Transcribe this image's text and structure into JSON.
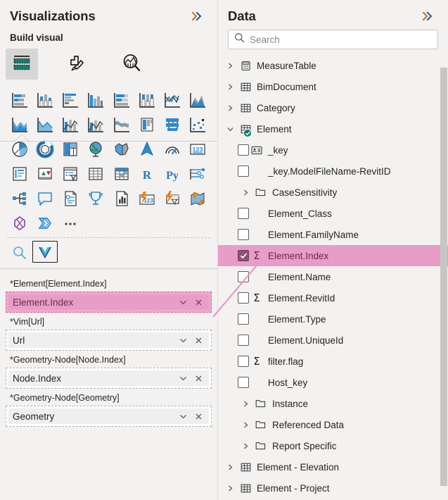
{
  "visualizations": {
    "title": "Visualizations",
    "expand_icon": "double-chevron-right-icon",
    "build_visual_label": "Build visual",
    "tabs": [
      {
        "id": "build",
        "label": "Build visual",
        "icon": "build-visual-icon",
        "selected": true
      },
      {
        "id": "format",
        "label": "Format visual",
        "icon": "paintbrush-icon",
        "selected": false
      },
      {
        "id": "analytics",
        "label": "Analytics",
        "icon": "analytics-magnifier-icon",
        "selected": false
      }
    ],
    "gallery": [
      "stacked-bar-chart-icon",
      "stacked-column-chart-icon",
      "clustered-bar-chart-icon",
      "clustered-column-chart-icon",
      "100-stacked-bar-chart-icon",
      "100-stacked-column-chart-icon",
      "line-chart-icon",
      "area-chart-icon",
      "stacked-area-chart-icon",
      "line-and-stacked-column-icon",
      "line-and-clustered-column-icon",
      "ribbon-chart-icon",
      "waterfall-chart-icon",
      "funnel-chart-icon",
      "scatter-chart-icon",
      "pie-chart-icon",
      "donut-chart-icon",
      "treemap-icon",
      "map-icon",
      "filled-map-icon",
      "azure-map-icon",
      "gauge-icon",
      "card-icon",
      "multi-row-card-icon",
      "kpi-icon",
      "slicer-icon",
      "table-icon",
      "matrix-icon",
      "r-script-visual-icon",
      "python-visual-icon",
      "key-influencers-icon",
      "decomposition-tree-icon",
      "q-and-a-icon",
      "smart-narrative-icon",
      "metrics-icon",
      "paginated-report-icon",
      "power-apps-icon",
      "power-automate-icon",
      "arcgis-maps-icon",
      "deneb-icon",
      "charticulator-icon",
      "more-options-icon"
    ],
    "bottom_row": [
      {
        "icon": "get-more-visuals-search-icon",
        "selected": false
      },
      {
        "icon": "custom-visual-icon",
        "selected": true
      }
    ],
    "wells": [
      {
        "label": "*Element[Element.Index]",
        "value": "Element.Index",
        "highlighted": true,
        "dropdown_icon": "chevron-down-icon",
        "remove_icon": "close-x-icon"
      },
      {
        "label": "*Vim[Url]",
        "value": "Url",
        "highlighted": false,
        "dropdown_icon": "chevron-down-icon",
        "remove_icon": "close-x-icon"
      },
      {
        "label": "*Geometry-Node[Node.Index]",
        "value": "Node.Index",
        "highlighted": false,
        "dropdown_icon": "chevron-down-icon",
        "remove_icon": "close-x-icon"
      },
      {
        "label": "*Geometry-Node[Geometry]",
        "value": "Geometry",
        "highlighted": false,
        "dropdown_icon": "chevron-down-icon",
        "remove_icon": "close-x-icon"
      }
    ]
  },
  "data_pane": {
    "title": "Data",
    "expand_icon": "double-chevron-right-icon",
    "search": {
      "value": "",
      "placeholder": "Search",
      "icon": "search-icon"
    },
    "tree": [
      {
        "label": "MeasureTable",
        "kind": "measure-table",
        "indent": 0,
        "twisty": "collapsed",
        "icon": "measure-table-icon"
      },
      {
        "label": "BimDocument",
        "kind": "table",
        "indent": 0,
        "twisty": "collapsed",
        "icon": "table-icon"
      },
      {
        "label": "Category",
        "kind": "table",
        "indent": 0,
        "twisty": "collapsed",
        "icon": "table-icon"
      },
      {
        "label": "Element",
        "kind": "table",
        "indent": 0,
        "twisty": "expanded",
        "icon": "table-icon",
        "badge": "active-check-badge"
      },
      {
        "label": "_key",
        "kind": "field",
        "indent": 1,
        "checked": false,
        "icon": "key-field-icon"
      },
      {
        "label": "_key.ModelFileName-RevitID",
        "kind": "field",
        "indent": 1,
        "checked": false
      },
      {
        "label": "CaseSensitivity",
        "kind": "folder",
        "indent": 1,
        "twisty": "collapsed",
        "icon": "folder-icon"
      },
      {
        "label": "Element_Class",
        "kind": "field",
        "indent": 1,
        "checked": false
      },
      {
        "label": "Element.FamilyName",
        "kind": "field",
        "indent": 1,
        "checked": false
      },
      {
        "label": "Element.Index",
        "kind": "field",
        "indent": 1,
        "checked": true,
        "measure": true,
        "selected": true
      },
      {
        "label": "Element.Name",
        "kind": "field",
        "indent": 1,
        "checked": false
      },
      {
        "label": "Element.RevitId",
        "kind": "field",
        "indent": 1,
        "checked": false,
        "measure": true
      },
      {
        "label": "Element.Type",
        "kind": "field",
        "indent": 1,
        "checked": false
      },
      {
        "label": "Element.UniqueId",
        "kind": "field",
        "indent": 1,
        "checked": false
      },
      {
        "label": "filter.flag",
        "kind": "field",
        "indent": 1,
        "checked": false,
        "measure": true
      },
      {
        "label": "Host_key",
        "kind": "field",
        "indent": 1,
        "checked": false
      },
      {
        "label": "Instance",
        "kind": "folder",
        "indent": 1,
        "twisty": "collapsed",
        "icon": "folder-icon"
      },
      {
        "label": "Referenced Data",
        "kind": "folder",
        "indent": 1,
        "twisty": "collapsed",
        "icon": "folder-icon"
      },
      {
        "label": "Report Specific",
        "kind": "folder",
        "indent": 1,
        "twisty": "collapsed",
        "icon": "folder-icon"
      },
      {
        "label": "Element - Elevation",
        "kind": "table",
        "indent": 0,
        "twisty": "collapsed",
        "icon": "table-icon"
      },
      {
        "label": "Element - Project",
        "kind": "table",
        "indent": 0,
        "twisty": "collapsed",
        "icon": "table-icon"
      }
    ],
    "scrollbar": "vertical-scrollbar"
  },
  "colors": {
    "pane_background": "#f3f2f1",
    "highlight_pink": "#e89dc6",
    "highlight_pink_border": "#cf5fa0",
    "highlight_text": "#6b2c4e",
    "checkbox_checked": "#8a5476",
    "accent_blue": "#118dff",
    "badge_green": "#0f7b6c",
    "text_primary": "#252423"
  }
}
